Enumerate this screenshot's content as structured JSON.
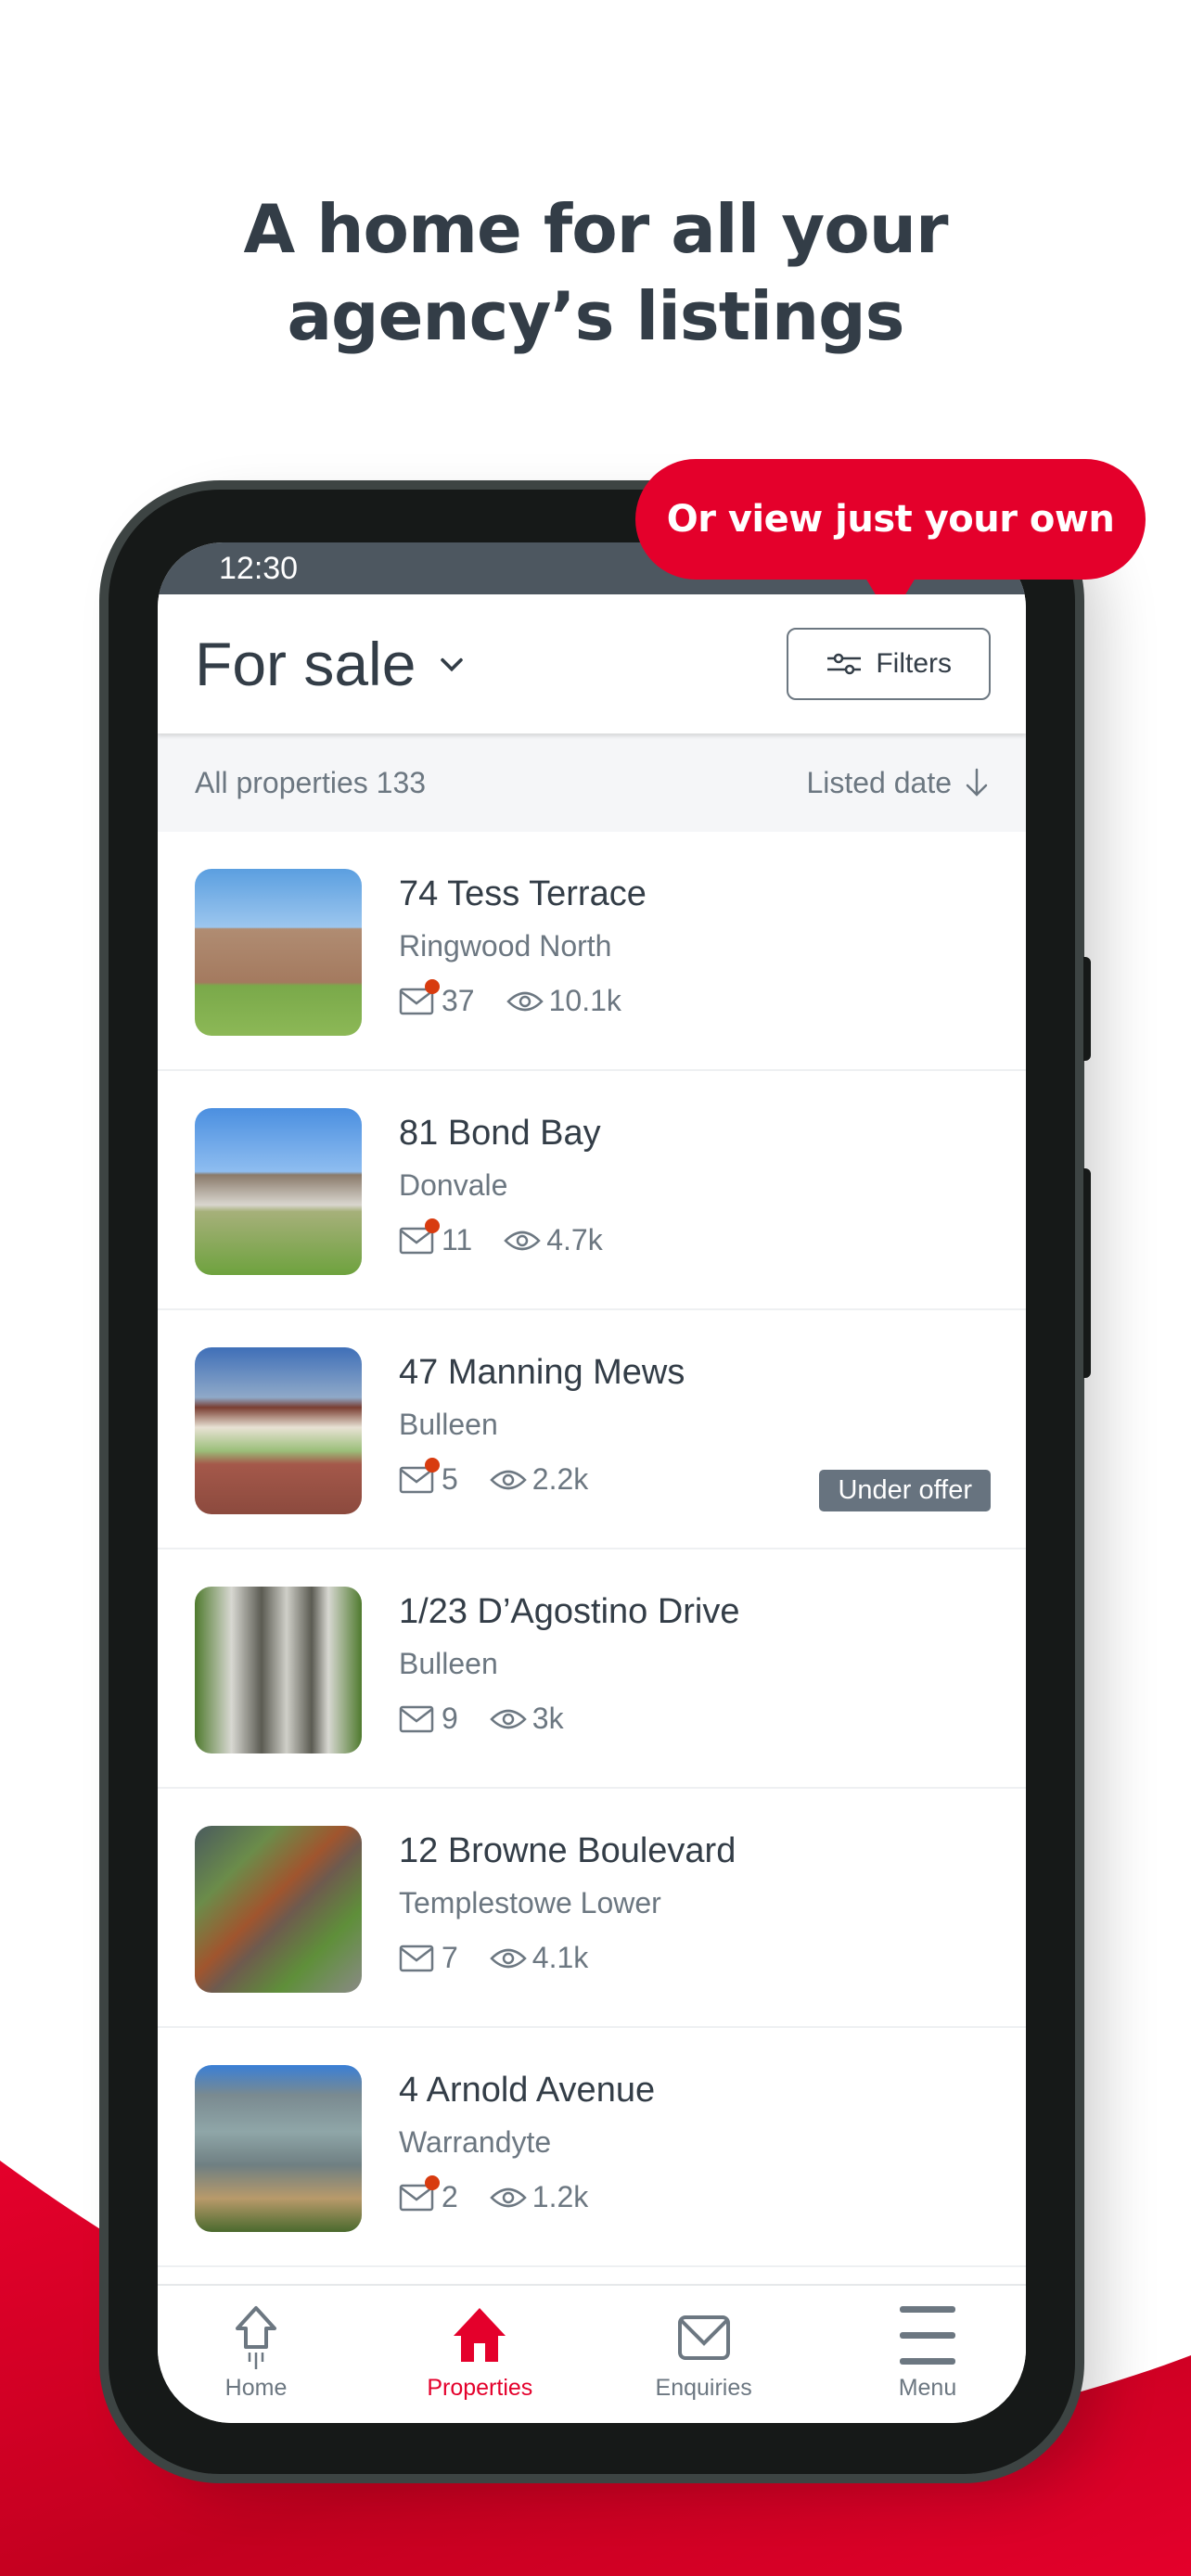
{
  "headline": {
    "line1": "A home for all your",
    "line2": "agency’s listings"
  },
  "callout": {
    "text": "Or view just your own"
  },
  "colors": {
    "brand_red": "#e4002b",
    "text_dark": "#333d47",
    "text_muted": "#6c7781",
    "badge_bg": "#67737f",
    "notification_dot": "#d83b0f",
    "status_bar": "#4d5760"
  },
  "status_bar": {
    "time": "12:30"
  },
  "app_bar": {
    "title": "For sale",
    "title_icon": "chevron-down-icon",
    "filters_label": "Filters",
    "filters_icon": "sliders-icon"
  },
  "sub_bar": {
    "count_label": "All properties 133",
    "sort_label": "Listed date",
    "sort_icon": "arrow-down-icon"
  },
  "listings": [
    {
      "address": "74 Tess Terrace",
      "suburb": "Ringwood North",
      "enquiries": "37",
      "views": "10.1k",
      "has_new_enquiry": true,
      "badge": ""
    },
    {
      "address": "81 Bond Bay",
      "suburb": "Donvale",
      "enquiries": "11",
      "views": "4.7k",
      "has_new_enquiry": true,
      "badge": ""
    },
    {
      "address": "47 Manning Mews",
      "suburb": "Bulleen",
      "enquiries": "5",
      "views": "2.2k",
      "has_new_enquiry": true,
      "badge": "Under offer"
    },
    {
      "address": "1/23 D’Agostino Drive",
      "suburb": "Bulleen",
      "enquiries": "9",
      "views": "3k",
      "has_new_enquiry": false,
      "badge": ""
    },
    {
      "address": "12 Browne Boulevard",
      "suburb": "Templestowe Lower",
      "enquiries": "7",
      "views": "4.1k",
      "has_new_enquiry": false,
      "badge": ""
    },
    {
      "address": "4 Arnold Avenue",
      "suburb": "Warrandyte",
      "enquiries": "2",
      "views": "1.2k",
      "has_new_enquiry": true,
      "badge": ""
    }
  ],
  "nav": {
    "items": [
      {
        "label": "Home",
        "icon": "home-outline-icon",
        "active": false
      },
      {
        "label": "Properties",
        "icon": "house-filled-icon",
        "active": true
      },
      {
        "label": "Enquiries",
        "icon": "envelope-icon",
        "active": false
      },
      {
        "label": "Menu",
        "icon": "hamburger-menu-icon",
        "active": false
      }
    ]
  }
}
